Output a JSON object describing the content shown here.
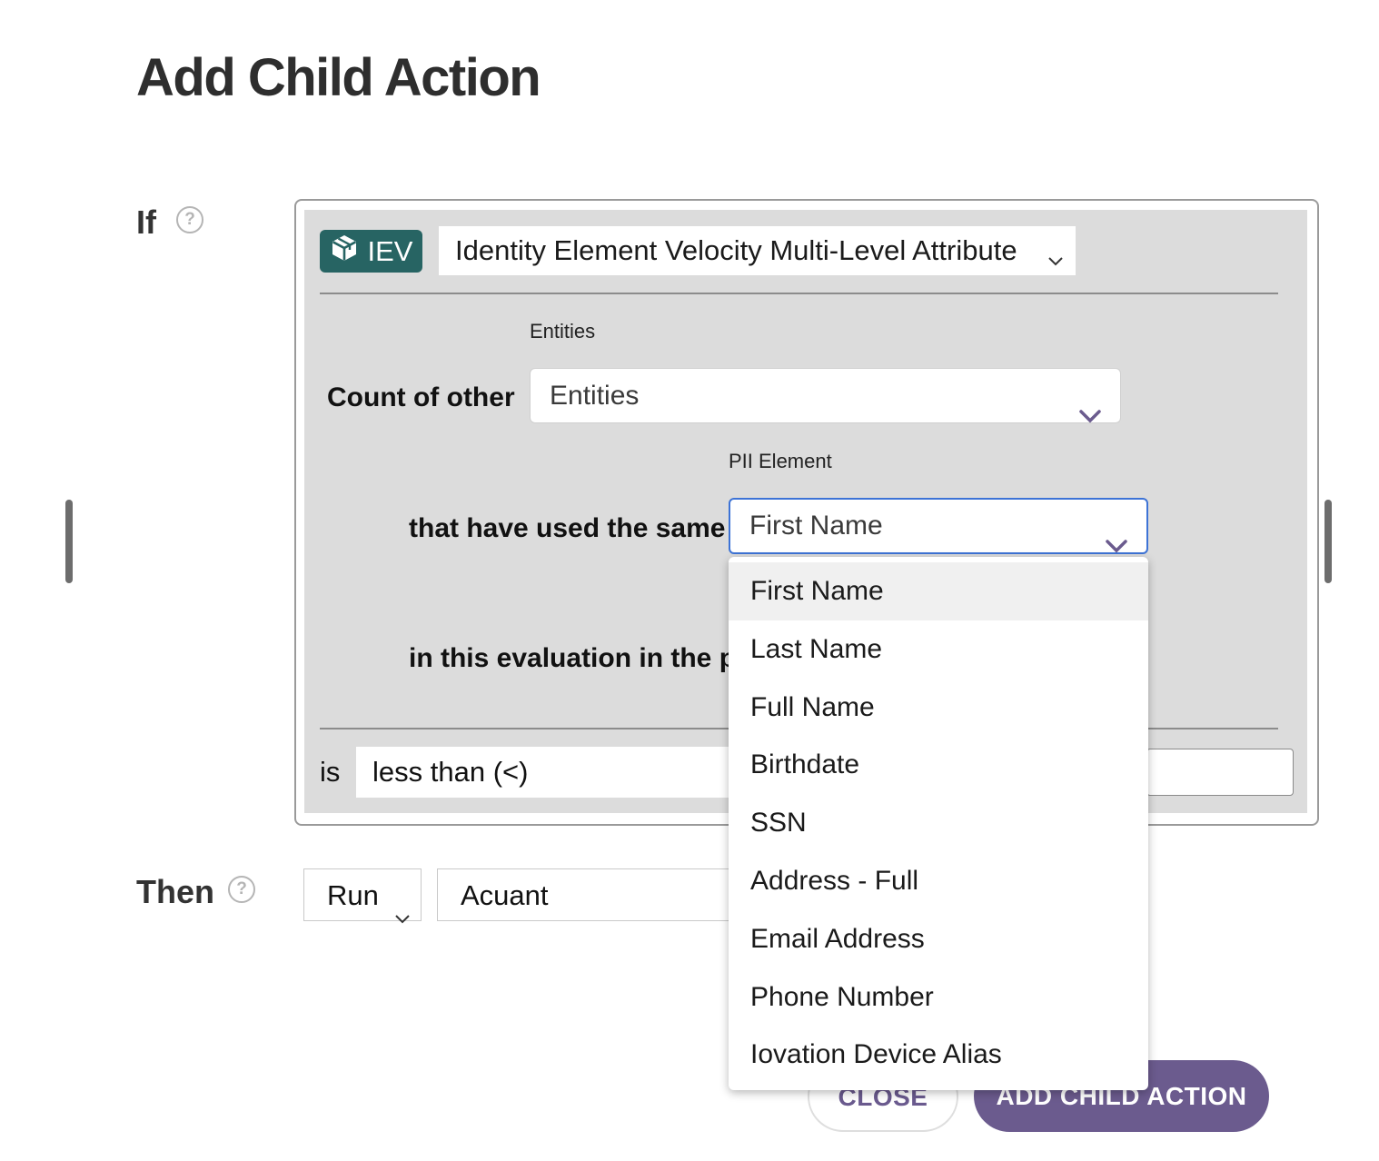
{
  "dialog": {
    "title": "Add Child Action"
  },
  "if_section": {
    "label": "If",
    "help_glyph": "?",
    "badge": {
      "icon": "cube-icon",
      "text": "IEV",
      "color": "#276463"
    },
    "attribute": {
      "value": "Identity Element Velocity Multi-Level Attribute"
    },
    "entities_caption": "Entities",
    "count_label": "Count  of other",
    "entities_select": {
      "value": "Entities"
    },
    "pii_caption": "PII Element",
    "used_same_label": "that have used the same",
    "pii_select": {
      "value": "First Name"
    },
    "evaluation_label": "in this evaluation in the past",
    "is_label": "is",
    "comparator": {
      "value": "less than (<)"
    },
    "threshold": {
      "value": ""
    }
  },
  "then_section": {
    "label": "Then",
    "help_glyph": "?",
    "action_select": {
      "value": "Run"
    },
    "target_select": {
      "value": "Acuant"
    }
  },
  "buttons": {
    "close": "CLOSE",
    "add": "ADD CHILD ACTION"
  },
  "pii_dropdown": {
    "selected": "First Name",
    "options": [
      "First Name",
      "Last Name",
      "Full Name",
      "Birthdate",
      "SSN",
      "Address - Full",
      "Email Address",
      "Phone Number",
      "Iovation Device Alias"
    ]
  },
  "colors": {
    "accent": "#6b5b8e",
    "focus_border": "#3d73d6",
    "panel_bg": "#dcdcdc"
  }
}
